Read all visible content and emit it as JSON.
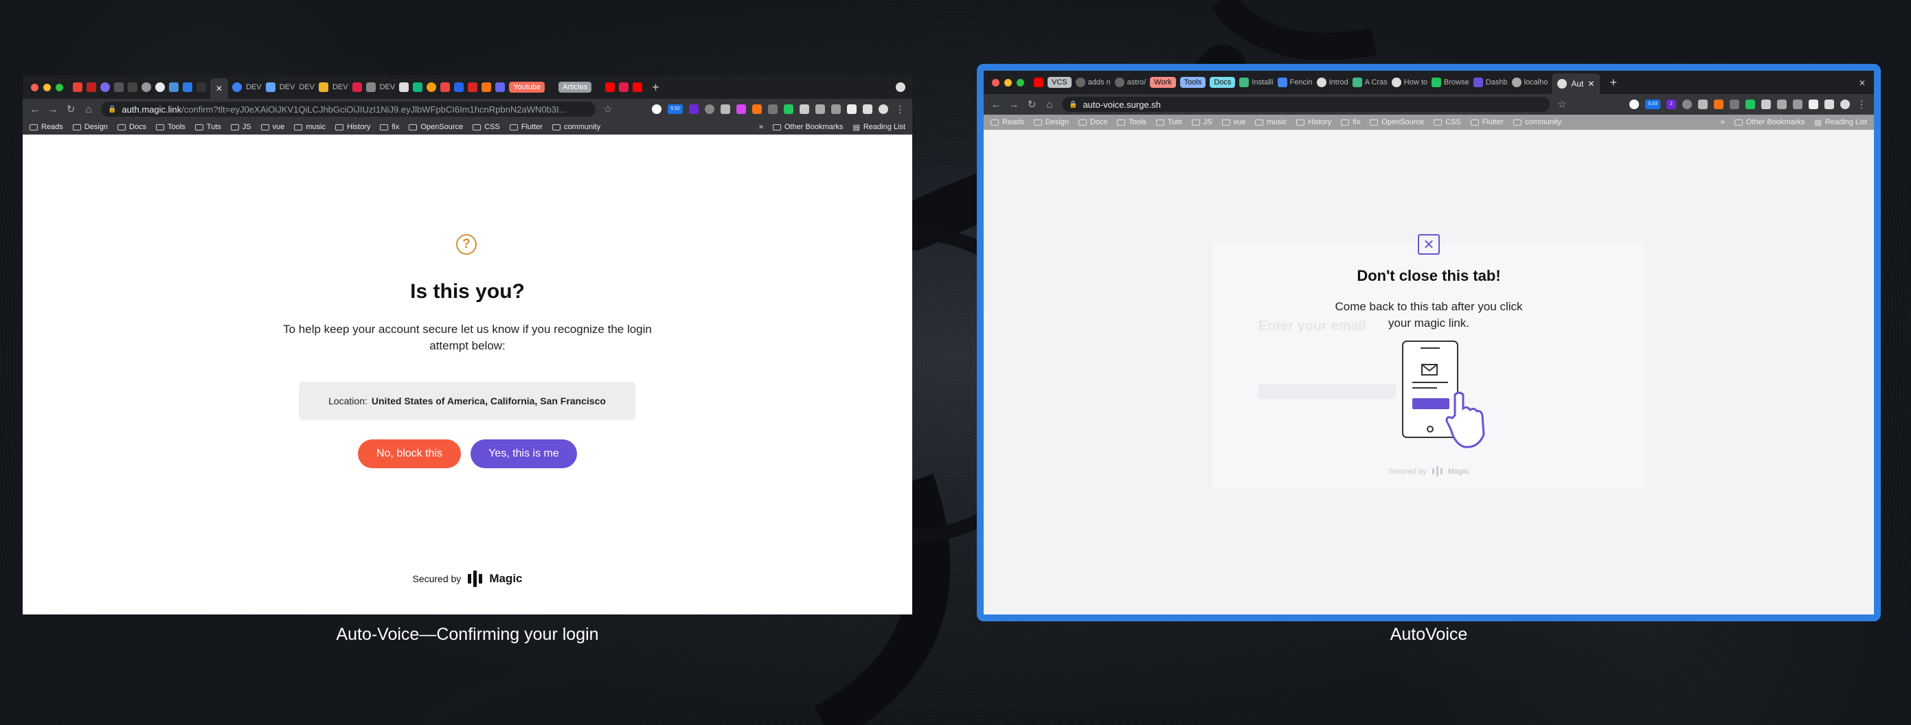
{
  "left_window": {
    "tabs": {
      "pill_youtube": "Youtube",
      "pill_articles": "Articles",
      "fav_labels": [
        "DEV",
        "DEV",
        "DEV",
        "DEV",
        "DEV"
      ]
    },
    "address": {
      "host": "auth.magic.link",
      "path": "/confirm?tlt=eyJ0eXAiOiJKV1QiLCJhbGciOiJIUzI1NiJ9.eyJlbWFpbCI6Im1hcnRpbnN2aWN0b3I..."
    },
    "ext_badge": "5.52",
    "bookmarks": [
      "Reads",
      "Design",
      "Docs",
      "Tools",
      "Tuts",
      "JS",
      "vue",
      "music",
      "History",
      "fix",
      "OpenSource",
      "CSS",
      "Flutter",
      "community"
    ],
    "bookmarks_right": [
      "Other Bookmarks",
      "Reading List"
    ],
    "page": {
      "title": "Is this you?",
      "subtitle": "To help keep your account secure let us know if you recognize the login attempt below:",
      "location_label": "Location:",
      "location_value": "United States of America, California, San Francisco",
      "block_button": "No, block this",
      "confirm_button": "Yes, this is me",
      "secured_by": "Secured by",
      "brand": "Magic"
    },
    "caption": "Auto-Voice—Confirming your login"
  },
  "right_window": {
    "tabs": {
      "pill_vcs": "VCS",
      "tab_adds": "adds n",
      "tab_astro": "astro/",
      "pill_work": "Work",
      "pill_tools": "Tools",
      "pill_docs": "Docs",
      "tab_install": "Installi",
      "tab_fencing": "Fencin",
      "tab_intro": "Introd",
      "tab_crash": "A Cras",
      "tab_howto": "How to",
      "tab_browse": "Browse",
      "tab_dash": "Dashb",
      "tab_localhost": "localho",
      "tab_active": "Aut"
    },
    "address": {
      "host": "auto-voice.surge.sh"
    },
    "ext_badges": [
      "5.53",
      "2"
    ],
    "bookmarks": [
      "Reads",
      "Design",
      "Docs",
      "Tools",
      "Tuts",
      "JS",
      "vue",
      "music",
      "History",
      "fix",
      "OpenSource",
      "CSS",
      "Flutter",
      "community"
    ],
    "bookmarks_right": [
      "Other Bookmarks",
      "Reading List"
    ],
    "page": {
      "title": "Don't close this tab!",
      "subtitle": "Come back to this tab after you click your magic link.",
      "ghost_heading": "Enter your email",
      "secured_by": "Secured by",
      "brand": "Magic"
    },
    "caption": "AutoVoice"
  },
  "colors": {
    "accent_purple": "#6851d6",
    "block_red": "#f55a3c",
    "question_orange": "#d4903a",
    "frame_blue": "#2f7fe0"
  }
}
